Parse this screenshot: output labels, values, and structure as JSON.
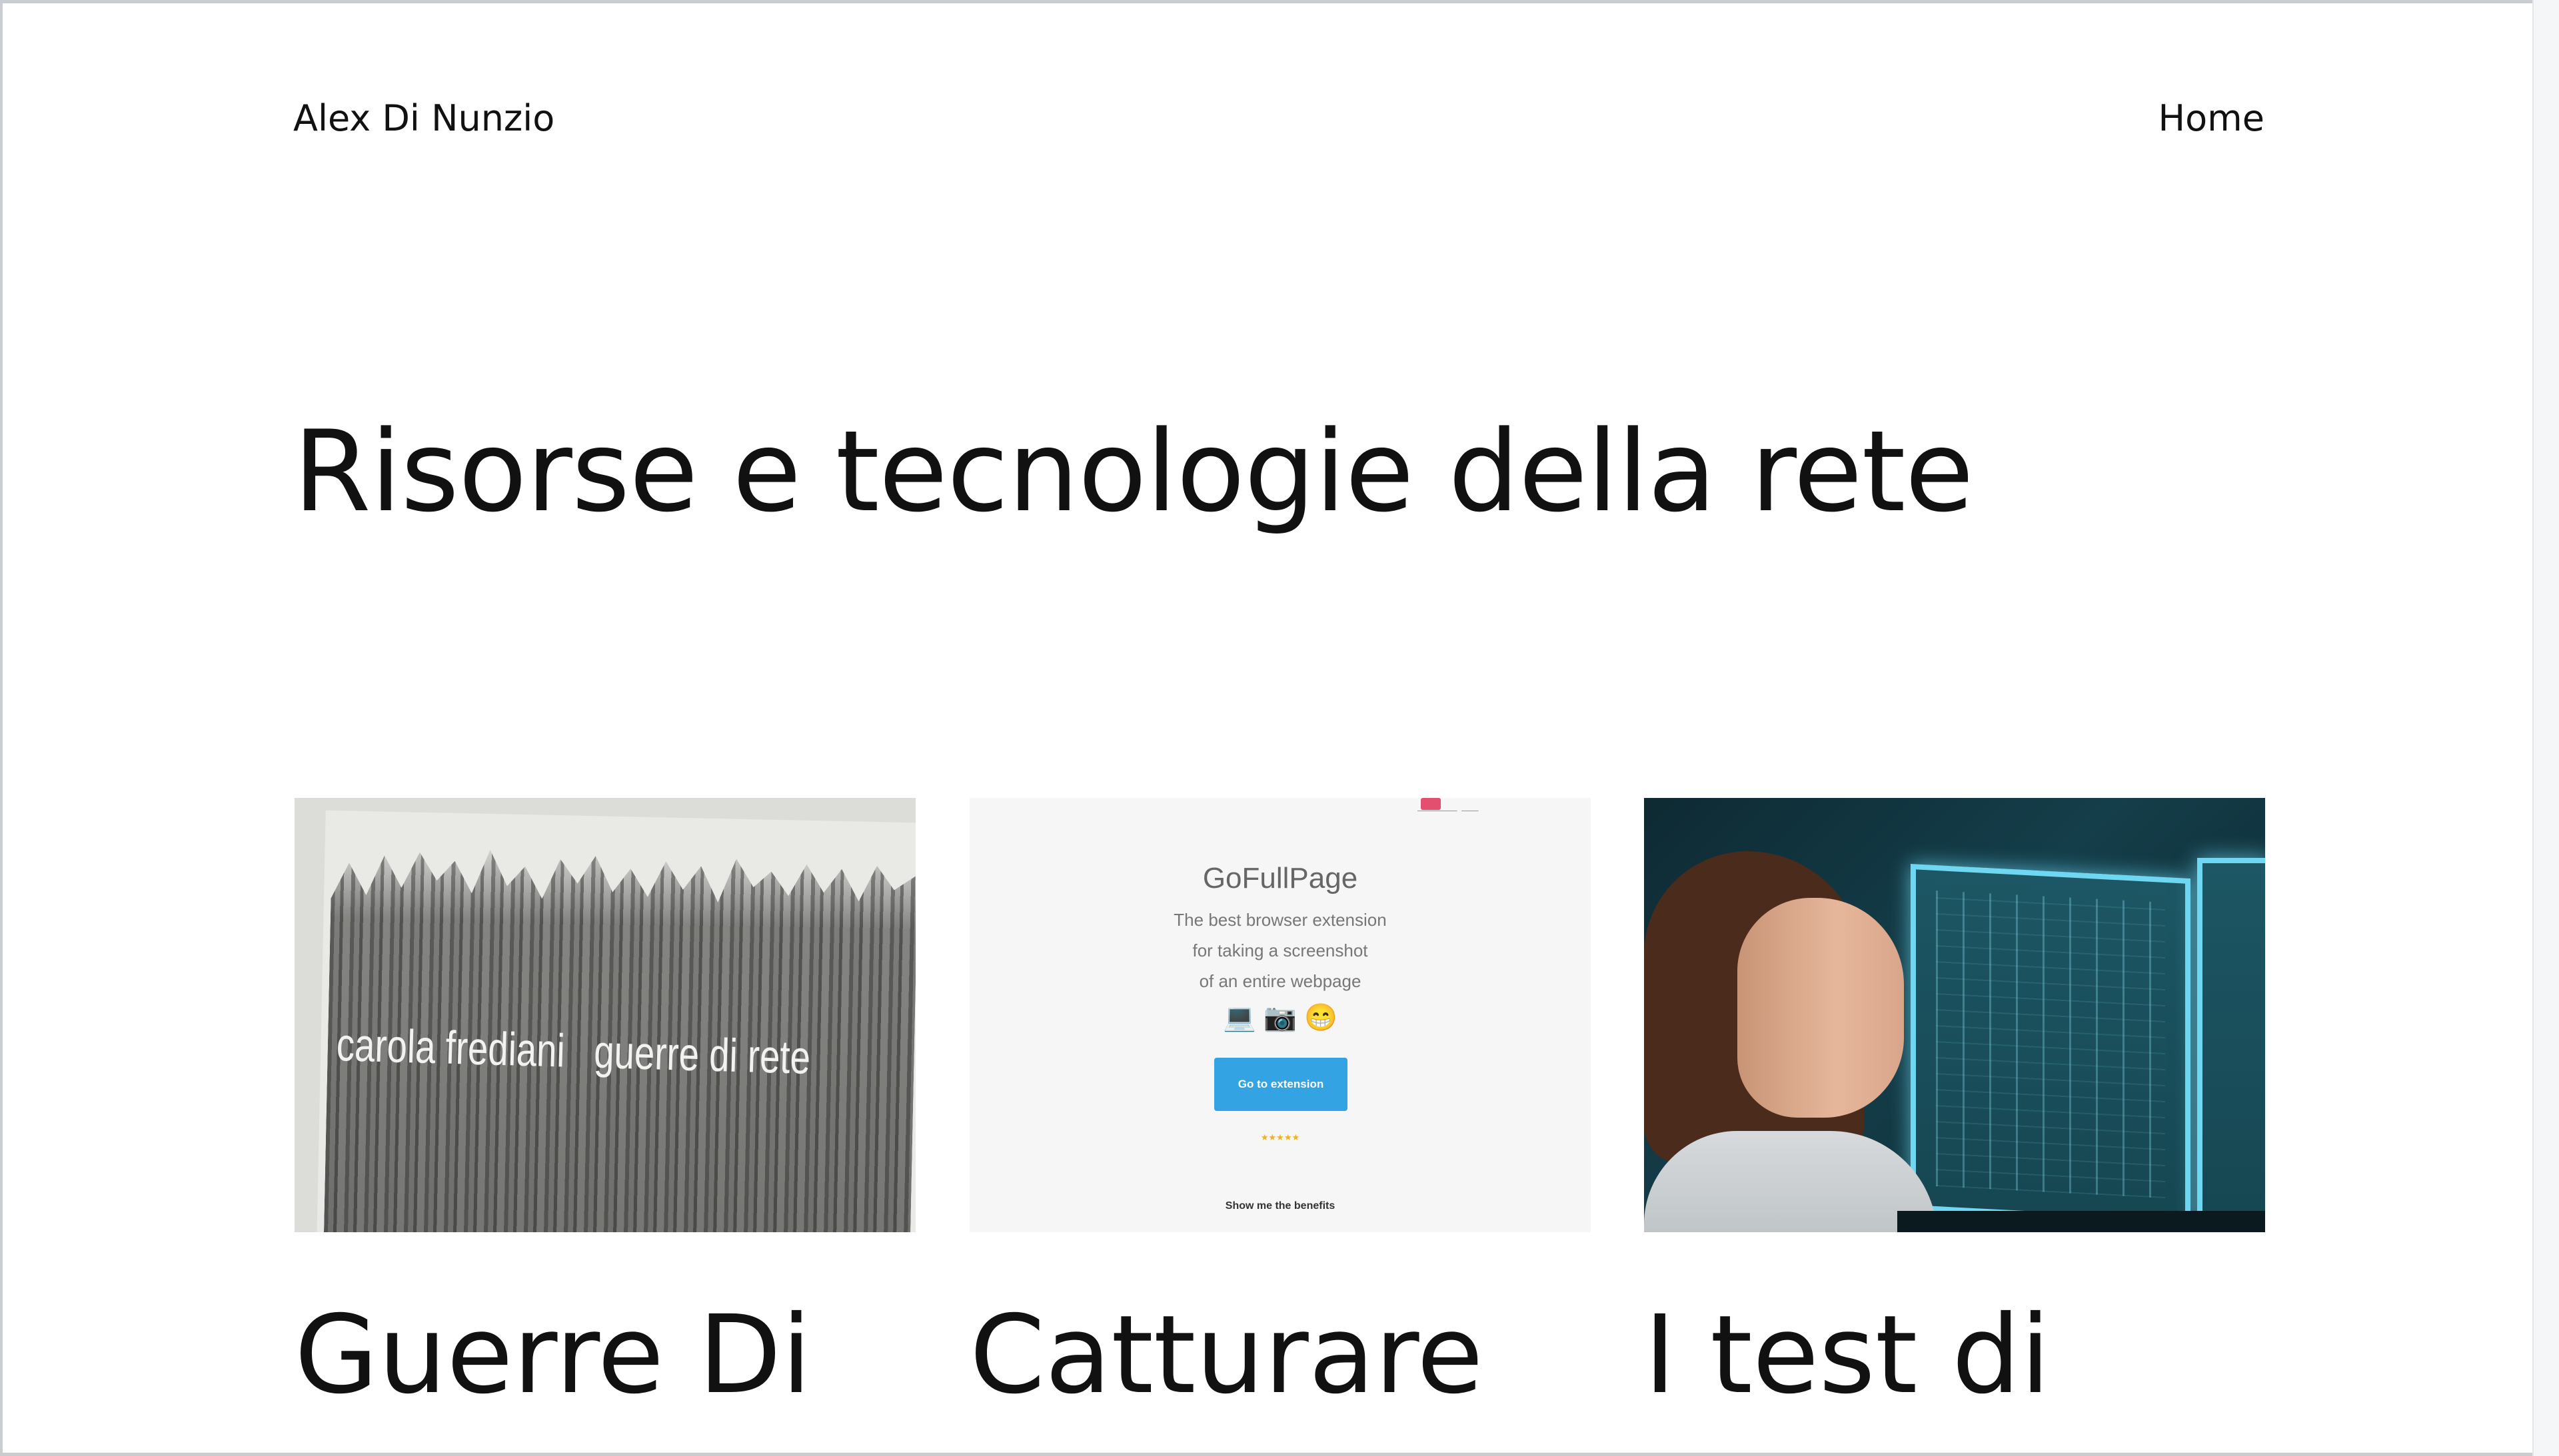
{
  "site": {
    "title": "Alex Di Nunzio",
    "nav": {
      "home_label": "Home"
    }
  },
  "page": {
    "title": "Risorse e tecnologie della rete"
  },
  "cards": [
    {
      "title": "Guerre Di",
      "image": {
        "cover_author": "carola frediani",
        "cover_title": "guerre di rete"
      }
    },
    {
      "title": "Catturare",
      "image": {
        "brand": "GoFullPage",
        "tagline_lines": [
          "The best browser extension",
          "for taking a screenshot",
          "of an entire webpage"
        ],
        "cta_label": "Go to extension",
        "benefits_label": "Show me the benefits"
      }
    },
    {
      "title": "I test di",
      "image": {}
    }
  ],
  "colors": {
    "text": "#111111",
    "background": "#ffffff",
    "accent_blue": "#33a3e4"
  }
}
